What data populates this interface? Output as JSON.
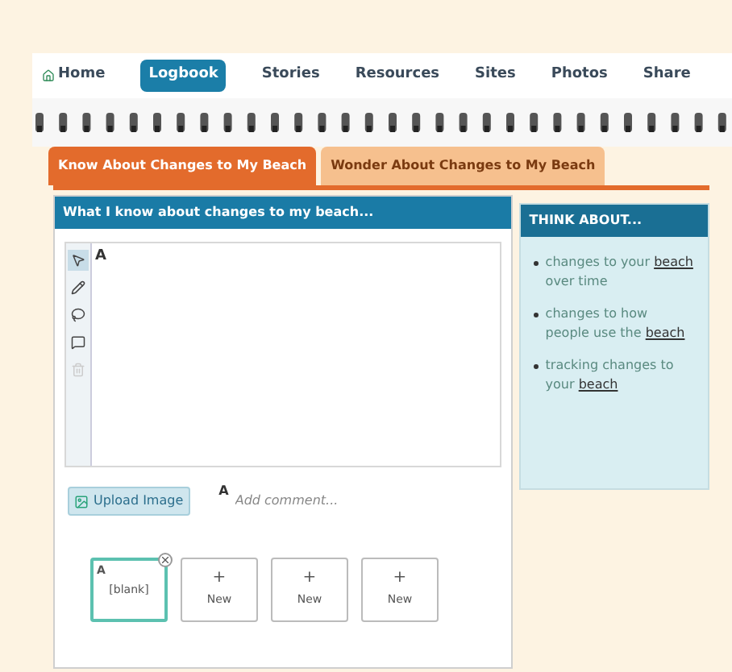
{
  "nav": [
    {
      "label": "Home",
      "kind": "home",
      "selected": false
    },
    {
      "label": "Logbook",
      "kind": "link",
      "selected": true
    },
    {
      "label": "Stories",
      "kind": "link",
      "selected": false
    },
    {
      "label": "Resources",
      "kind": "link",
      "selected": false
    },
    {
      "label": "Sites",
      "kind": "link",
      "selected": false
    },
    {
      "label": "Photos",
      "kind": "link",
      "selected": false
    },
    {
      "label": "Share",
      "kind": "link",
      "selected": false
    }
  ],
  "tabs": [
    {
      "label": "Know About Changes to My Beach",
      "selected": true
    },
    {
      "label": "Wonder About Changes to My Beach",
      "selected": false
    }
  ],
  "panel": {
    "title": "What I know about changes to my beach...",
    "tools": [
      {
        "kind": "pointer",
        "selected": true,
        "disabled": false
      },
      {
        "kind": "pencil",
        "selected": false,
        "disabled": false
      },
      {
        "kind": "lasso",
        "selected": false,
        "disabled": false
      },
      {
        "kind": "comment",
        "selected": false,
        "disabled": false
      },
      {
        "kind": "trash",
        "selected": false,
        "disabled": true
      }
    ],
    "canvas_text_marker": "A",
    "upload_button": "Upload Image",
    "comment_marker": "A",
    "comment": {
      "placeholder": "Add comment..."
    },
    "pages": [
      {
        "kind": "page",
        "marker": "A",
        "label": "[blank]",
        "selected": true
      },
      {
        "kind": "new",
        "marker": "+",
        "label": "New",
        "selected": false
      },
      {
        "kind": "new",
        "marker": "+",
        "label": "New",
        "selected": false
      },
      {
        "kind": "new",
        "marker": "+",
        "label": "New",
        "selected": false
      }
    ]
  },
  "sidebar": {
    "title": "THINK ABOUT...",
    "items": [
      {
        "before": "changes to your",
        "link": "beach",
        "after": "over time"
      },
      {
        "before": "changes to how people use the",
        "link": "beach"
      },
      {
        "before": "tracking changes to your",
        "link": "beach"
      }
    ]
  }
}
